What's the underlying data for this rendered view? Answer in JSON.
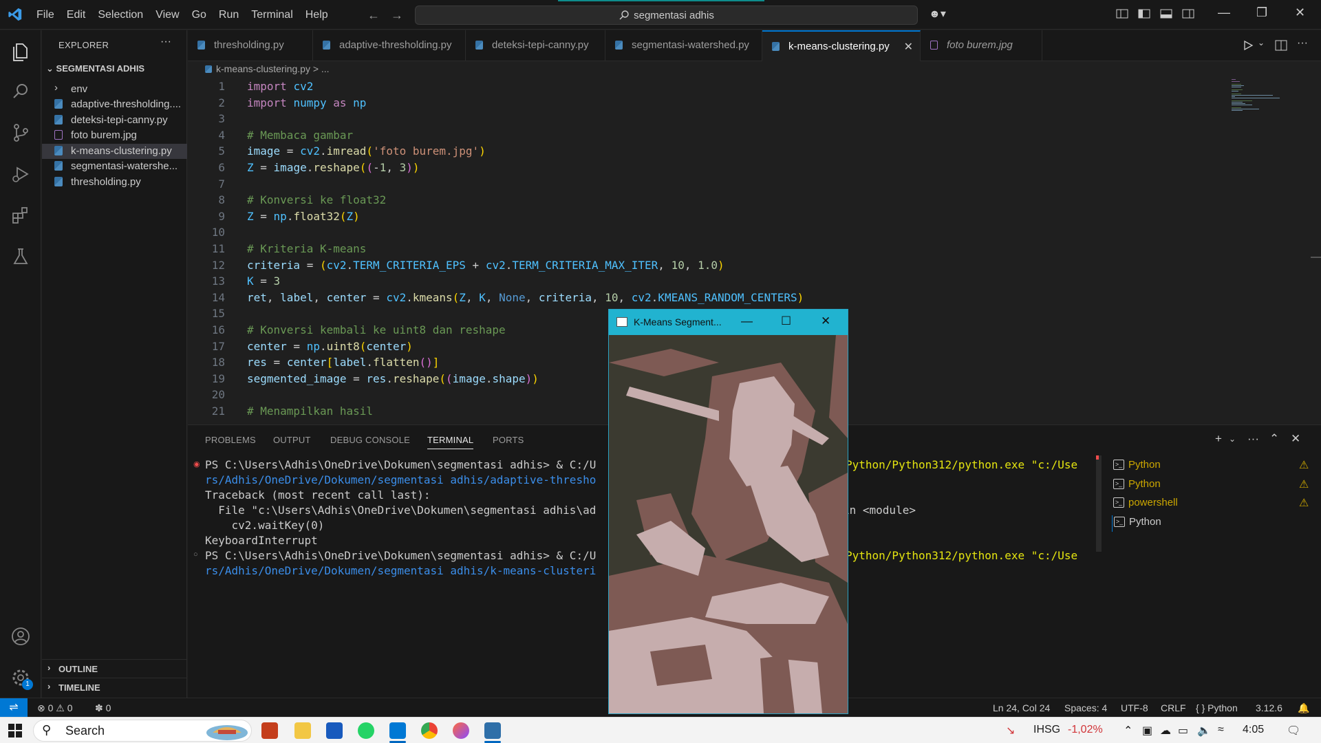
{
  "titlebar": {
    "menu": [
      "File",
      "Edit",
      "Selection",
      "View",
      "Go",
      "Run",
      "Terminal",
      "Help"
    ],
    "search": "segmentasi adhis"
  },
  "explorer": {
    "header": "EXPLORER",
    "folder": "SEGMENTASI ADHIS",
    "items": [
      {
        "label": "env",
        "type": "folder"
      },
      {
        "label": "adaptive-thresholding....",
        "type": "py"
      },
      {
        "label": "deteksi-tepi-canny.py",
        "type": "py"
      },
      {
        "label": "foto burem.jpg",
        "type": "img"
      },
      {
        "label": "k-means-clustering.py",
        "type": "py"
      },
      {
        "label": "segmentasi-watershe...",
        "type": "py"
      },
      {
        "label": "thresholding.py",
        "type": "py"
      }
    ],
    "outline": "OUTLINE",
    "timeline": "TIMELINE",
    "settings_badge": "1"
  },
  "tabs": [
    {
      "label": "thresholding.py"
    },
    {
      "label": "adaptive-thresholding.py"
    },
    {
      "label": "deteksi-tepi-canny.py"
    },
    {
      "label": "segmentasi-watershed.py"
    },
    {
      "label": "k-means-clustering.py",
      "active": true
    },
    {
      "label": "foto burem.jpg"
    }
  ],
  "breadcrumb": "k-means-clustering.py > ...",
  "editor": {
    "line_numbers": [
      "1",
      "2",
      "3",
      "4",
      "5",
      "6",
      "7",
      "8",
      "9",
      "10",
      "11",
      "12",
      "13",
      "14",
      "15",
      "16",
      "17",
      "18",
      "19",
      "20",
      "21"
    ]
  },
  "panel": {
    "tabs": [
      "PROBLEMS",
      "OUTPUT",
      "DEBUG CONSOLE",
      "TERMINAL",
      "PORTS"
    ],
    "terminal_lines": [
      "PS C:\\Users\\Adhis\\OneDrive\\Dokumen\\segmentasi adhis> & C:/U",
      "rs/Adhis/OneDrive/Dokumen/segmentasi adhis/adaptive-thresho",
      "Traceback (most recent call last):",
      "  File \"c:\\Users\\Adhis\\OneDrive\\Dokumen\\segmentasi adhis\\ad",
      "    cv2.waitKey(0)",
      "KeyboardInterrupt",
      "PS C:\\Users\\Adhis\\OneDrive\\Dokumen\\segmentasi adhis> & C:/U",
      "rs/Adhis/OneDrive/Dokumen/segmentasi adhis/k-means-clusteri"
    ],
    "terminal_right": [
      "Python/Python312/python.exe \"c:/Use",
      "in <module>",
      "Python/Python312/python.exe \"c:/Use"
    ],
    "terminal_list": [
      "Python",
      "Python",
      "powershell",
      "Python"
    ]
  },
  "statusbar": {
    "errors": "0",
    "warnings": "0",
    "ports": "0",
    "position": "Ln 24, Col 24",
    "spaces": "Spaces: 4",
    "encoding": "UTF-8",
    "eol": "CRLF",
    "language": "Python",
    "version": "3.12.6"
  },
  "taskbar": {
    "search": "Search",
    "ticker": "IHSG",
    "ticker_change": "-1,02%",
    "time": "4:05"
  },
  "popup": {
    "title": "K-Means Segment..."
  },
  "colors": {
    "accent": "#0078d4",
    "popup_titlebar": "#21b3d0",
    "seg_dark": "#3b3a30",
    "seg_mid": "#7e5a54",
    "seg_light": "#c6adad"
  }
}
